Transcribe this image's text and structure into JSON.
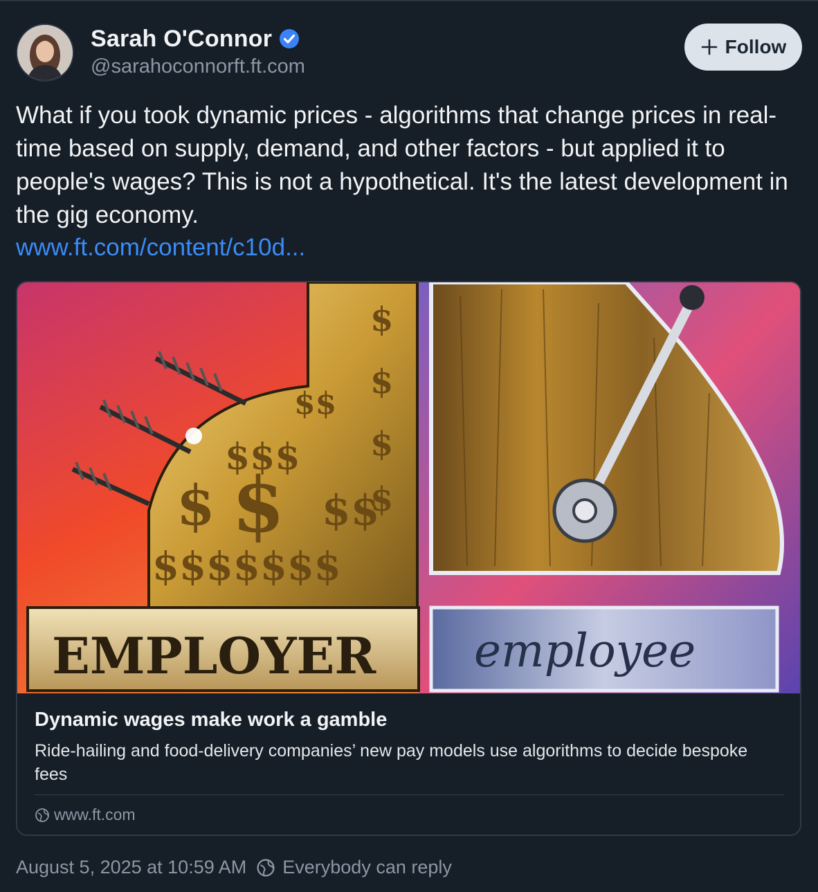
{
  "author": {
    "name": "Sarah O'Connor",
    "handle": "@sarahoconnorft.ft.com",
    "verified_color": "#3b82f6"
  },
  "follow_button": {
    "icon": "plus-icon",
    "label": "Follow"
  },
  "post": {
    "text": "What if you took dynamic prices - algorithms that change prices in real-time based on supply, demand, and other factors - but applied it to people's wages? This is not a hypothetical. It's the latest development in the gig economy.",
    "link_text": "www.ft.com/content/c10d..."
  },
  "link_card": {
    "image_labels": {
      "left": "EMPLOYER",
      "right": "employee"
    },
    "title": "Dynamic wages make work a gamble",
    "description": "Ride-hailing and food-delivery companies’ new pay models use algorithms to decide bespoke fees",
    "domain": "www.ft.com",
    "domain_icon": "globe-icon"
  },
  "footer": {
    "timestamp": "August 5, 2025 at 10:59 AM",
    "reply_setting": "Everybody can reply",
    "reply_icon": "globe-icon"
  },
  "colors": {
    "background": "#161e27",
    "link": "#3b8cf7",
    "muted": "#8c98a6",
    "follow_bg": "#dde3ea"
  }
}
